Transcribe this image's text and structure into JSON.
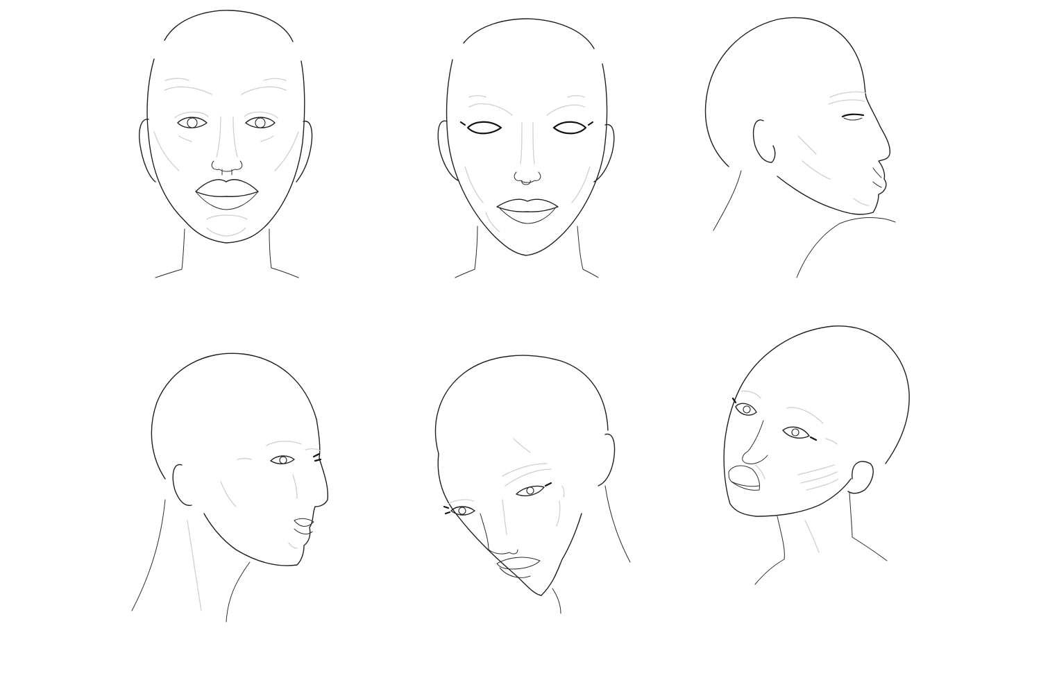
{
  "sheet": {
    "background_color": "#ffffff",
    "line_color": "#1f1f1f",
    "light_line_color": "#cfcfcf"
  },
  "heads": [
    {
      "pose": "front"
    },
    {
      "pose": "front-stylized"
    },
    {
      "pose": "profile-right"
    },
    {
      "pose": "three-quarter-right"
    },
    {
      "pose": "tilted-down-left"
    },
    {
      "pose": "tilted-up-left"
    }
  ]
}
